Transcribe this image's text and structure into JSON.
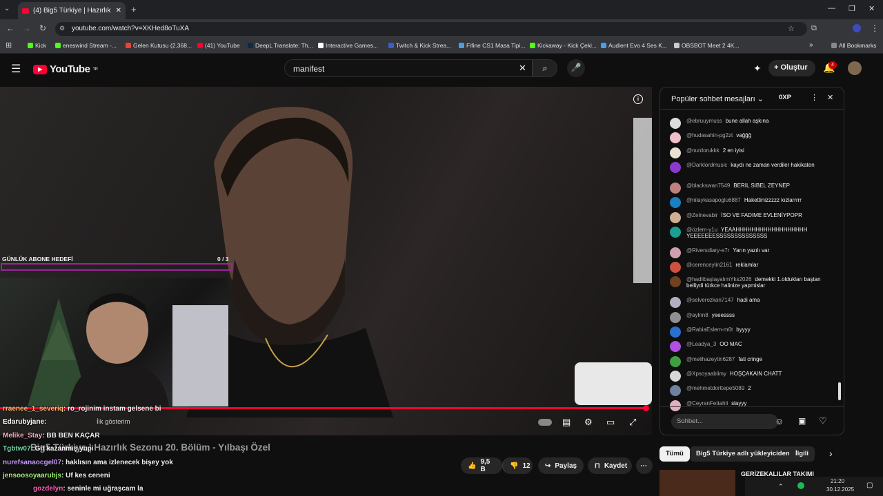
{
  "browser": {
    "tab_title": "(4) Big5 Türkiye | Hazırlık Sezon",
    "url": "youtube.com/watch?v=XKHed8oTuXA",
    "bookmarks": [
      "Kick",
      "eneswind Stream -...",
      "Gelen Kutusu (2.368...",
      "(41) YouTube",
      "DeepL Translate: Th...",
      "Interactive Games...",
      "Twitch & Kick Strea...",
      "Fifine CS1 Masa Tipi...",
      "Kickaway - Kick Çeki...",
      "Audient Evo 4 Ses K...",
      "OBSBOT Meet 2 4K..."
    ],
    "all_bookmarks": "All Bookmarks"
  },
  "youtube": {
    "logo_text": "YouTube",
    "logo_sup": "TR",
    "search_value": "manifest",
    "create_label": "Oluştur",
    "notif_count": "4"
  },
  "overlay": {
    "goal_label": "GÜNLÜK ABONE HEDEFİ",
    "goal_count": "0  / 3",
    "goal_progress": 0,
    "chat": [
      {
        "user": "rraenee_1_severiq",
        "color": "#f0c070",
        "text": ": ro_rojinim instam gelsene bi"
      },
      {
        "user": "Edarubyjane",
        "color": "#ffffff",
        "text": ":"
      },
      {
        "user": "Melike_Stay",
        "color": "#f7a8c0",
        "text": ": BB BEN KAÇAR"
      },
      {
        "user": "Tgbtw07",
        "color": "#6fd6a0",
        "text": ": Git kazanmış yupi"
      },
      {
        "user": "nurefsanaocgel07",
        "color": "#c89bff",
        "text": ": haklısın ama izlenecek bişey yok"
      },
      {
        "user": "jensoosoyaarubjs",
        "color": "#9ff070",
        "text": ": Uf kes ceneni"
      },
      {
        "user": "gozdelyn",
        "color": "#ff5ab4",
        "text": ": seninle mi uğraşcam la"
      }
    ],
    "first_show": "İlk gösterim"
  },
  "video": {
    "title": "Big5 Türkiye | Hazırlık Sezonu 20. Bölüm - Yılbaşı Özel",
    "progress": 0.99
  },
  "actions": {
    "likes": "9,5 B",
    "dislikes": "12",
    "share": "Paylaş",
    "save": "Kaydet"
  },
  "live_chat": {
    "header": "Popüler sohbet mesajları",
    "xp": "0XP",
    "input_placeholder": "Sohbet...",
    "messages": [
      {
        "author": "@ebruuymuss",
        "text": "bune allah aşkına",
        "color": "#ddd"
      },
      {
        "author": "@hudasahin-pg2zt",
        "text": "vağğğ",
        "color": "#f0c0c8"
      },
      {
        "author": "@nurdorukkk",
        "text": "2 en iyisi",
        "color": "#e8e0d0"
      },
      {
        "author": "@Darklordmusic",
        "text": "kaydı ne zaman verdiler hakikaten",
        "color": "#8a3ad0"
      },
      {
        "author": "@blackswan7549",
        "text": "BERIL SIBEL ZEYNEP",
        "color": "#c08080"
      },
      {
        "author": "@nilaykasapoglu6887",
        "text": "Hakettinizzzzz kızlarrrrr",
        "color": "#1a80c0"
      },
      {
        "author": "@Zelnevabir",
        "text": "İSO VE FADIME EVLENİYPOPR",
        "color": "#d0b090"
      },
      {
        "author": "@özlem-y1u",
        "text": "YEAAHHHHHHHHHHHHHHHHHH YEEEEEEESSSSSSSSSSSSSS",
        "color": "#1aa090"
      },
      {
        "author": "@Riversdiary-e7r",
        "text": "Yarın yazılı var",
        "color": "#d0a0b0"
      },
      {
        "author": "@cerenceylin2161",
        "text": "reklamlar",
        "color": "#d05040"
      },
      {
        "author": "@hadiibaşlayalımYks2026",
        "text": "demekki 1.oldukları baştan belliydi türkce halinize yapmislar",
        "color": "#704020"
      },
      {
        "author": "@selverozkan7147",
        "text": "hadi ama",
        "color": "#b0b0c0"
      },
      {
        "author": "@aylnn8",
        "text": "yeeessss",
        "color": "#909090"
      },
      {
        "author": "@RabiaEslem-m6t",
        "text": "byyyy",
        "color": "#2a70d0"
      },
      {
        "author": "@Leadya_3",
        "text": "OO MAC",
        "color": "#b050e0"
      },
      {
        "author": "@melihazeytin6287",
        "text": "fati cringe",
        "color": "#40a040"
      },
      {
        "author": "@Xpsoyaablimy",
        "text": "HOŞÇAKAIN CHATT",
        "color": "#d8d8d8"
      },
      {
        "author": "@mehmetdorttepe5089",
        "text": "2",
        "color": "#7080a0"
      },
      {
        "author": "@CeyranFettahli",
        "text": "slayyy",
        "color": "#e0b0c0"
      }
    ]
  },
  "chips": [
    "Tümü",
    "Big5 Türkiye adlı yükleyiciden",
    "İlgili"
  ],
  "recommendation": {
    "title": "GERİZEKALILAR TAKIMI"
  },
  "taskbar": {
    "time": "21:20",
    "date": "30.12.2025"
  }
}
